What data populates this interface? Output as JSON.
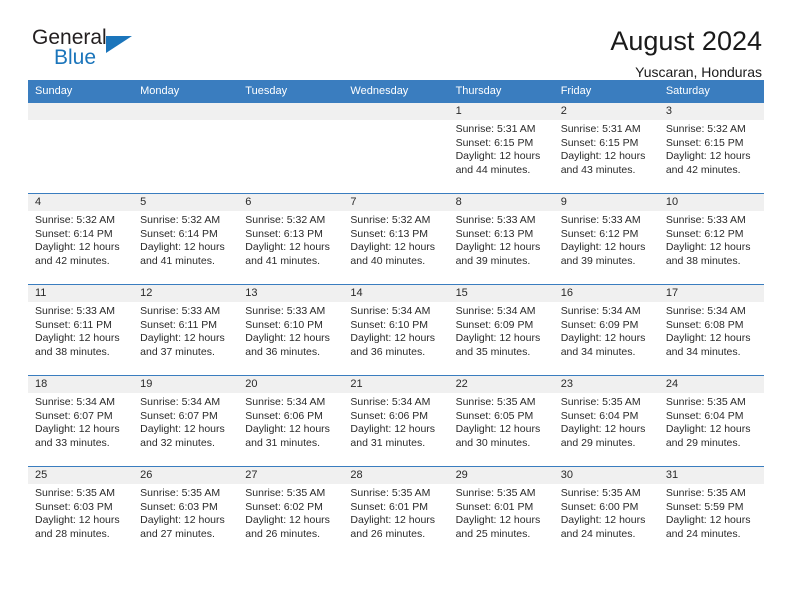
{
  "logo": {
    "part1": "General",
    "part2": "Blue",
    "triangle_color": "#1b75bb",
    "text_color": "#231f20"
  },
  "header": {
    "title": "August 2024",
    "subtitle": "Yuscaran, Honduras"
  },
  "theme": {
    "header_bg": "#3a7dbf",
    "header_text": "#ffffff",
    "daynum_bg": "#f0f0f0",
    "row_border": "#3a7dbf"
  },
  "weekdays": [
    "Sunday",
    "Monday",
    "Tuesday",
    "Wednesday",
    "Thursday",
    "Friday",
    "Saturday"
  ],
  "labels": {
    "sunrise": "Sunrise:",
    "sunset": "Sunset:",
    "daylight": "Daylight:"
  },
  "weeks": [
    [
      {
        "day": ""
      },
      {
        "day": ""
      },
      {
        "day": ""
      },
      {
        "day": ""
      },
      {
        "day": "1",
        "sunrise": "Sunrise: 5:31 AM",
        "sunset": "Sunset: 6:15 PM",
        "daylight": "Daylight: 12 hours and 44 minutes."
      },
      {
        "day": "2",
        "sunrise": "Sunrise: 5:31 AM",
        "sunset": "Sunset: 6:15 PM",
        "daylight": "Daylight: 12 hours and 43 minutes."
      },
      {
        "day": "3",
        "sunrise": "Sunrise: 5:32 AM",
        "sunset": "Sunset: 6:15 PM",
        "daylight": "Daylight: 12 hours and 42 minutes."
      }
    ],
    [
      {
        "day": "4",
        "sunrise": "Sunrise: 5:32 AM",
        "sunset": "Sunset: 6:14 PM",
        "daylight": "Daylight: 12 hours and 42 minutes."
      },
      {
        "day": "5",
        "sunrise": "Sunrise: 5:32 AM",
        "sunset": "Sunset: 6:14 PM",
        "daylight": "Daylight: 12 hours and 41 minutes."
      },
      {
        "day": "6",
        "sunrise": "Sunrise: 5:32 AM",
        "sunset": "Sunset: 6:13 PM",
        "daylight": "Daylight: 12 hours and 41 minutes."
      },
      {
        "day": "7",
        "sunrise": "Sunrise: 5:32 AM",
        "sunset": "Sunset: 6:13 PM",
        "daylight": "Daylight: 12 hours and 40 minutes."
      },
      {
        "day": "8",
        "sunrise": "Sunrise: 5:33 AM",
        "sunset": "Sunset: 6:13 PM",
        "daylight": "Daylight: 12 hours and 39 minutes."
      },
      {
        "day": "9",
        "sunrise": "Sunrise: 5:33 AM",
        "sunset": "Sunset: 6:12 PM",
        "daylight": "Daylight: 12 hours and 39 minutes."
      },
      {
        "day": "10",
        "sunrise": "Sunrise: 5:33 AM",
        "sunset": "Sunset: 6:12 PM",
        "daylight": "Daylight: 12 hours and 38 minutes."
      }
    ],
    [
      {
        "day": "11",
        "sunrise": "Sunrise: 5:33 AM",
        "sunset": "Sunset: 6:11 PM",
        "daylight": "Daylight: 12 hours and 38 minutes."
      },
      {
        "day": "12",
        "sunrise": "Sunrise: 5:33 AM",
        "sunset": "Sunset: 6:11 PM",
        "daylight": "Daylight: 12 hours and 37 minutes."
      },
      {
        "day": "13",
        "sunrise": "Sunrise: 5:33 AM",
        "sunset": "Sunset: 6:10 PM",
        "daylight": "Daylight: 12 hours and 36 minutes."
      },
      {
        "day": "14",
        "sunrise": "Sunrise: 5:34 AM",
        "sunset": "Sunset: 6:10 PM",
        "daylight": "Daylight: 12 hours and 36 minutes."
      },
      {
        "day": "15",
        "sunrise": "Sunrise: 5:34 AM",
        "sunset": "Sunset: 6:09 PM",
        "daylight": "Daylight: 12 hours and 35 minutes."
      },
      {
        "day": "16",
        "sunrise": "Sunrise: 5:34 AM",
        "sunset": "Sunset: 6:09 PM",
        "daylight": "Daylight: 12 hours and 34 minutes."
      },
      {
        "day": "17",
        "sunrise": "Sunrise: 5:34 AM",
        "sunset": "Sunset: 6:08 PM",
        "daylight": "Daylight: 12 hours and 34 minutes."
      }
    ],
    [
      {
        "day": "18",
        "sunrise": "Sunrise: 5:34 AM",
        "sunset": "Sunset: 6:07 PM",
        "daylight": "Daylight: 12 hours and 33 minutes."
      },
      {
        "day": "19",
        "sunrise": "Sunrise: 5:34 AM",
        "sunset": "Sunset: 6:07 PM",
        "daylight": "Daylight: 12 hours and 32 minutes."
      },
      {
        "day": "20",
        "sunrise": "Sunrise: 5:34 AM",
        "sunset": "Sunset: 6:06 PM",
        "daylight": "Daylight: 12 hours and 31 minutes."
      },
      {
        "day": "21",
        "sunrise": "Sunrise: 5:34 AM",
        "sunset": "Sunset: 6:06 PM",
        "daylight": "Daylight: 12 hours and 31 minutes."
      },
      {
        "day": "22",
        "sunrise": "Sunrise: 5:35 AM",
        "sunset": "Sunset: 6:05 PM",
        "daylight": "Daylight: 12 hours and 30 minutes."
      },
      {
        "day": "23",
        "sunrise": "Sunrise: 5:35 AM",
        "sunset": "Sunset: 6:04 PM",
        "daylight": "Daylight: 12 hours and 29 minutes."
      },
      {
        "day": "24",
        "sunrise": "Sunrise: 5:35 AM",
        "sunset": "Sunset: 6:04 PM",
        "daylight": "Daylight: 12 hours and 29 minutes."
      }
    ],
    [
      {
        "day": "25",
        "sunrise": "Sunrise: 5:35 AM",
        "sunset": "Sunset: 6:03 PM",
        "daylight": "Daylight: 12 hours and 28 minutes."
      },
      {
        "day": "26",
        "sunrise": "Sunrise: 5:35 AM",
        "sunset": "Sunset: 6:03 PM",
        "daylight": "Daylight: 12 hours and 27 minutes."
      },
      {
        "day": "27",
        "sunrise": "Sunrise: 5:35 AM",
        "sunset": "Sunset: 6:02 PM",
        "daylight": "Daylight: 12 hours and 26 minutes."
      },
      {
        "day": "28",
        "sunrise": "Sunrise: 5:35 AM",
        "sunset": "Sunset: 6:01 PM",
        "daylight": "Daylight: 12 hours and 26 minutes."
      },
      {
        "day": "29",
        "sunrise": "Sunrise: 5:35 AM",
        "sunset": "Sunset: 6:01 PM",
        "daylight": "Daylight: 12 hours and 25 minutes."
      },
      {
        "day": "30",
        "sunrise": "Sunrise: 5:35 AM",
        "sunset": "Sunset: 6:00 PM",
        "daylight": "Daylight: 12 hours and 24 minutes."
      },
      {
        "day": "31",
        "sunrise": "Sunrise: 5:35 AM",
        "sunset": "Sunset: 5:59 PM",
        "daylight": "Daylight: 12 hours and 24 minutes."
      }
    ]
  ]
}
